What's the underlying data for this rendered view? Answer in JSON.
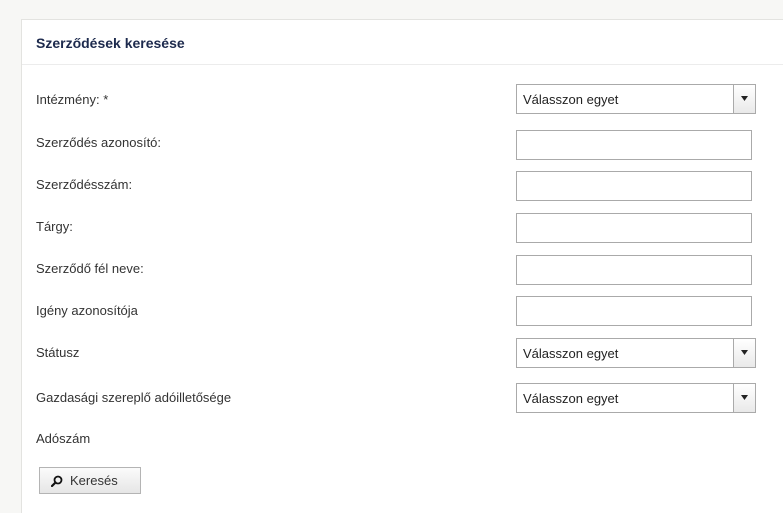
{
  "panel": {
    "title": "Szerződések keresése"
  },
  "form": {
    "institution": {
      "label": "Intézmény: *",
      "value": "Válasszon egyet"
    },
    "contract_id": {
      "label": "Szerződés azonosító:",
      "value": ""
    },
    "contract_number": {
      "label": "Szerződésszám:",
      "value": ""
    },
    "subject": {
      "label": "Tárgy:",
      "value": ""
    },
    "contracting_party": {
      "label": "Szerződő fél neve:",
      "value": ""
    },
    "request_id": {
      "label": "Igény azonosítója",
      "value": ""
    },
    "status": {
      "label": "Státusz",
      "value": "Válasszon egyet"
    },
    "tax_residency": {
      "label": "Gazdasági szereplő adóilletősége",
      "value": "Válasszon egyet"
    },
    "tax_number": {
      "label": "Adószám"
    }
  },
  "actions": {
    "search_label": "Keresés",
    "search_icon": "search-icon"
  },
  "colors": {
    "title": "#1d2a4d",
    "border": "#aaaaaa",
    "background": "#f7f7f5"
  }
}
